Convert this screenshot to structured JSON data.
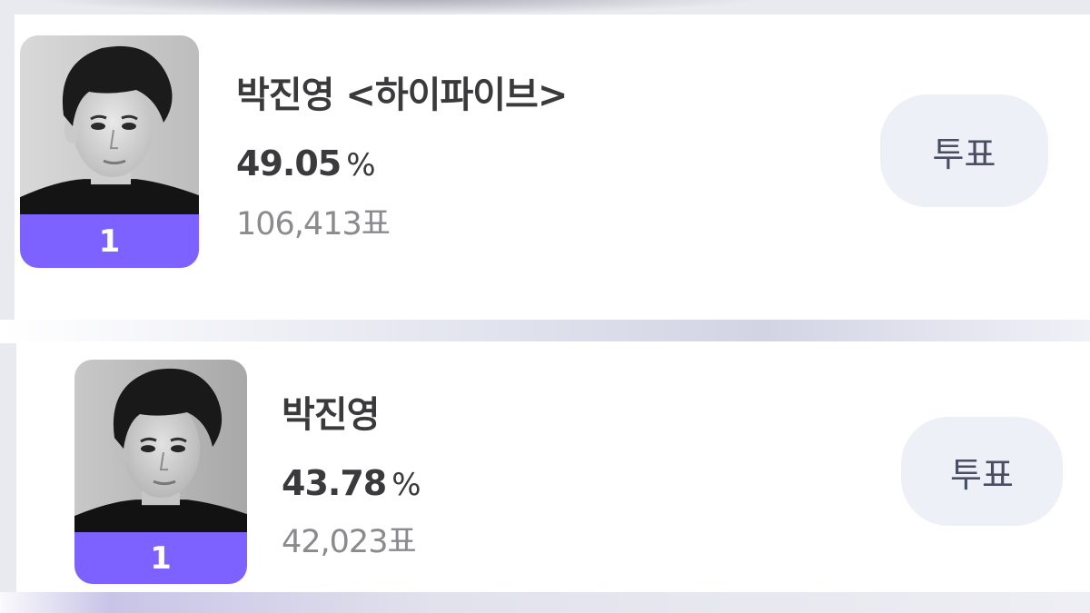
{
  "candidates": [
    {
      "name": "박진영 <하이파이브>",
      "percent": "49.05",
      "percent_unit": "%",
      "votes": "106,413표",
      "rank": "1",
      "vote_button_label": "투표"
    },
    {
      "name": "박진영",
      "percent": "43.78",
      "percent_unit": "%",
      "votes": "42,023표",
      "rank": "1",
      "vote_button_label": "투표"
    }
  ],
  "colors": {
    "rank_bar": "#7d62ff",
    "vote_button_bg": "#eef0f7",
    "vote_button_text": "#4a4e63",
    "name_text": "#3a3a3d",
    "votes_text": "#8a8a8f"
  }
}
